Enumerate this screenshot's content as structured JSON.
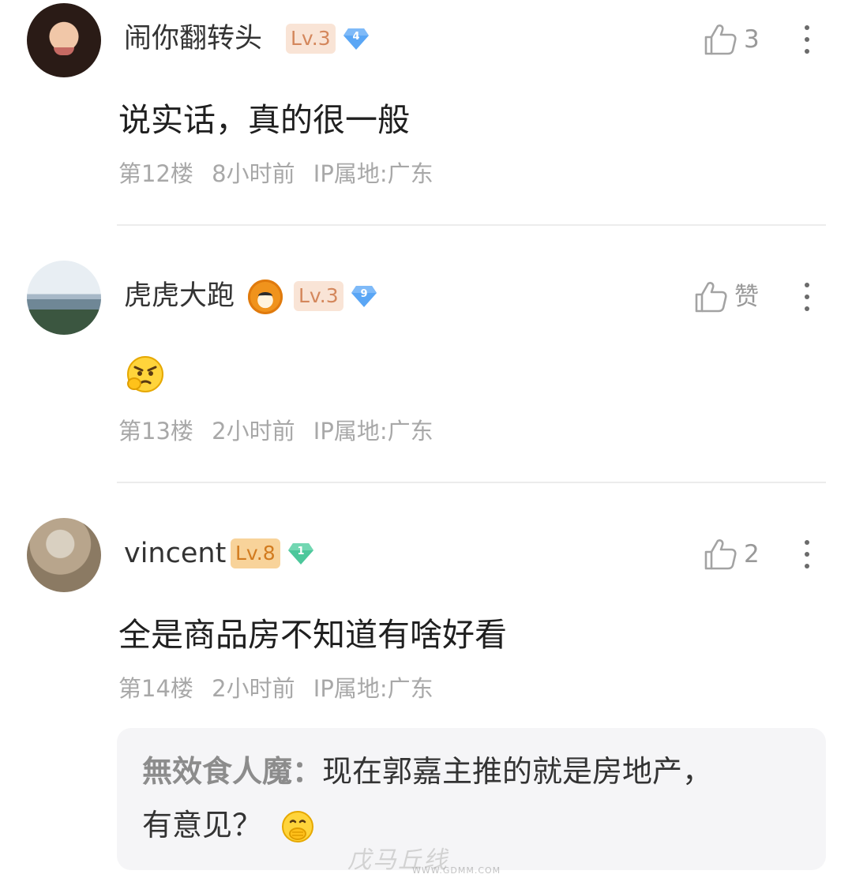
{
  "comments": [
    {
      "username": "闹你翻转头",
      "level": "Lv.3",
      "gem_number": "4",
      "gem_color": "#5aa6f5",
      "like_count": "3",
      "content": "说实话，真的很一般",
      "floor": "第12楼",
      "time": "8小时前",
      "ip": "IP属地:广东"
    },
    {
      "username": "虎虎大跑",
      "level": "Lv.3",
      "gem_number": "9",
      "gem_color": "#5aa6f5",
      "like_count": "赞",
      "content_emoji": "angry-thinking-emoji",
      "floor": "第13楼",
      "time": "2小时前",
      "ip": "IP属地:广东"
    },
    {
      "username": "vincent",
      "level": "Lv.8",
      "gem_number": "1",
      "gem_color": "#4cc79b",
      "like_count": "2",
      "content": "全是商品房不知道有啥好看",
      "floor": "第14楼",
      "time": "2小时前",
      "ip": "IP属地:广东",
      "reply": {
        "author": "無效食人魔",
        "separator": "：",
        "text_line1": "现在郭嘉主推的就是房地产，",
        "text_line2": "有意见？",
        "emoji": "cover-mouth-emoji"
      }
    }
  ],
  "watermark": {
    "text": "戊马丘线",
    "sub": "WWW.GDMM.COM"
  }
}
